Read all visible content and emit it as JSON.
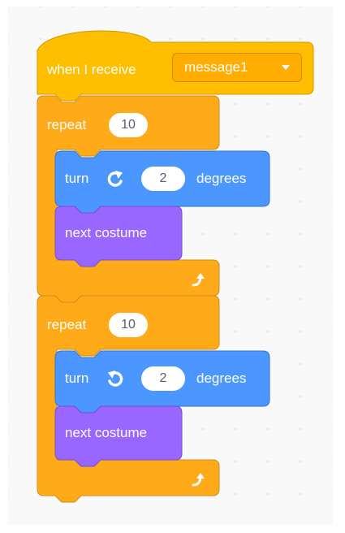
{
  "event_block": {
    "label": "when I receive",
    "message_value": "message1"
  },
  "loops": [
    {
      "label": "repeat",
      "count": "10",
      "turn": {
        "label": "turn",
        "direction_icon": "rotate-clockwise-icon",
        "degrees_value": "2",
        "unit_label": "degrees"
      },
      "looks": {
        "label": "next costume"
      },
      "loop_arrow_icon": "loop-arrow-icon"
    },
    {
      "label": "repeat",
      "count": "10",
      "turn": {
        "label": "turn",
        "direction_icon": "rotate-counterclockwise-icon",
        "degrees_value": "2",
        "unit_label": "degrees"
      },
      "looks": {
        "label": "next costume"
      },
      "loop_arrow_icon": "loop-arrow-icon"
    }
  ],
  "colors": {
    "events": "#ffbf00",
    "control": "#ffab19",
    "motion": "#4c97ff",
    "looks": "#9966ff",
    "workspace": "#f9f9f9"
  }
}
